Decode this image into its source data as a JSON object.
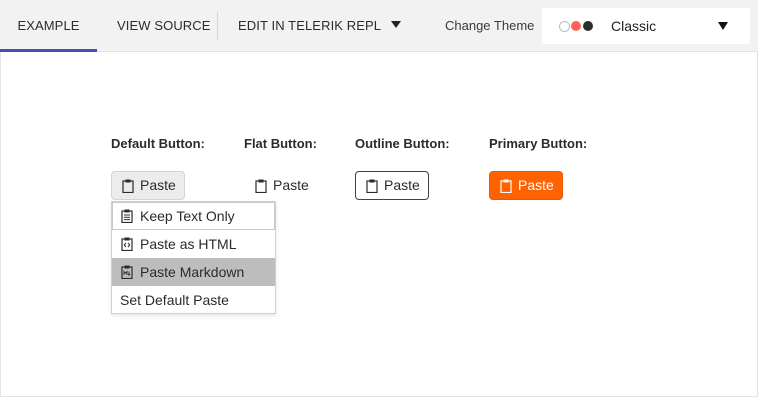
{
  "toolbar": {
    "tabs": [
      {
        "label": "EXAMPLE",
        "active": true
      },
      {
        "label": "VIEW SOURCE",
        "active": false
      },
      {
        "label": "EDIT IN TELERIK REPL",
        "active": false
      }
    ],
    "change_theme_label": "Change Theme",
    "theme_select": {
      "value": "Classic",
      "swatch_colors": [
        "#ffffff",
        "#ff6358",
        "#2d2d2d"
      ]
    },
    "accent_color": "#3f51b5"
  },
  "demo": {
    "labels": {
      "default": "Default Button:",
      "flat": "Flat Button:",
      "outline": "Outline Button:",
      "primary": "Primary Button:"
    },
    "buttons": {
      "default": {
        "label": "Paste",
        "icon": "clipboard-icon"
      },
      "flat": {
        "label": "Paste",
        "icon": "clipboard-icon"
      },
      "outline": {
        "label": "Paste",
        "icon": "clipboard-icon"
      },
      "primary": {
        "label": "Paste",
        "icon": "clipboard-icon",
        "color": "#ff6200"
      }
    },
    "menu": {
      "items": [
        {
          "label": "Keep Text Only",
          "icon": "clipboard-text-icon"
        },
        {
          "label": "Paste as HTML",
          "icon": "clipboard-code-icon"
        },
        {
          "label": "Paste Markdown",
          "icon": "clipboard-markdown-icon"
        },
        {
          "label": "Set Default Paste",
          "icon": ""
        }
      ]
    }
  }
}
